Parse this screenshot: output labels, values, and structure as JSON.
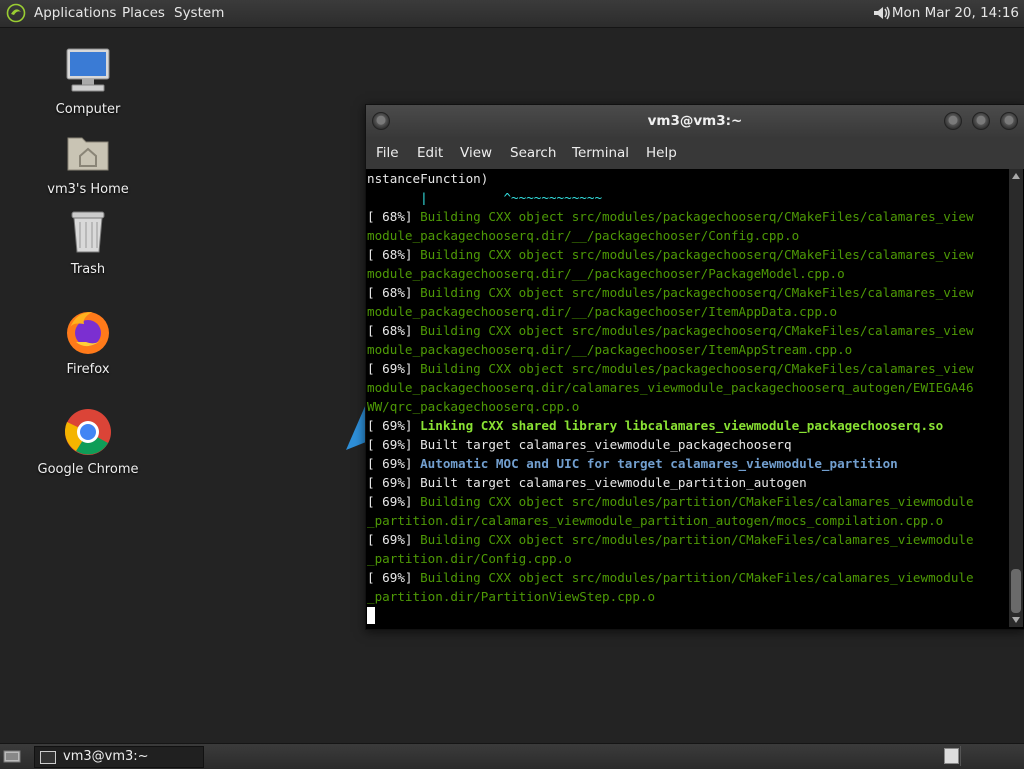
{
  "top_panel": {
    "menus": [
      "Applications",
      "Places",
      "System"
    ],
    "clock": "Mon Mar 20, 14:16"
  },
  "desktop_icons": [
    {
      "label": "Computer",
      "icon": "computer-icon"
    },
    {
      "label": "vm3's Home",
      "icon": "home-folder-icon"
    },
    {
      "label": "Trash",
      "icon": "trash-icon"
    },
    {
      "label": "Firefox",
      "icon": "firefox-icon"
    },
    {
      "label": "Google Chrome",
      "icon": "chrome-icon"
    }
  ],
  "terminal": {
    "title": "vm3@vm3:~",
    "menu": [
      "File",
      "Edit",
      "View",
      "Search",
      "Terminal",
      "Help"
    ],
    "lines": [
      {
        "prefix": "",
        "text": "nstanceFunction)",
        "style": ""
      },
      {
        "prefix": "",
        "text": "       |          ^~~~~~~~~~~~~",
        "style": "cy"
      },
      {
        "prefix": "[ 68%] ",
        "text": "Building CXX object src/modules/packagechooserq/CMakeFiles/calamares_view",
        "style": "g"
      },
      {
        "prefix": "",
        "text": "module_packagechooserq.dir/__/packagechooser/Config.cpp.o",
        "style": "g"
      },
      {
        "prefix": "[ 68%] ",
        "text": "Building CXX object src/modules/packagechooserq/CMakeFiles/calamares_view",
        "style": "g"
      },
      {
        "prefix": "",
        "text": "module_packagechooserq.dir/__/packagechooser/PackageModel.cpp.o",
        "style": "g"
      },
      {
        "prefix": "[ 68%] ",
        "text": "Building CXX object src/modules/packagechooserq/CMakeFiles/calamares_view",
        "style": "g"
      },
      {
        "prefix": "",
        "text": "module_packagechooserq.dir/__/packagechooser/ItemAppData.cpp.o",
        "style": "g"
      },
      {
        "prefix": "[ 68%] ",
        "text": "Building CXX object src/modules/packagechooserq/CMakeFiles/calamares_view",
        "style": "g"
      },
      {
        "prefix": "",
        "text": "module_packagechooserq.dir/__/packagechooser/ItemAppStream.cpp.o",
        "style": "g"
      },
      {
        "prefix": "[ 69%] ",
        "text": "Building CXX object src/modules/packagechooserq/CMakeFiles/calamares_view",
        "style": "g"
      },
      {
        "prefix": "",
        "text": "module_packagechooserq.dir/calamares_viewmodule_packagechooserq_autogen/EWIEGA46",
        "style": "g"
      },
      {
        "prefix": "",
        "text": "WW/qrc_packagechooserq.cpp.o",
        "style": "g"
      },
      {
        "prefix": "[ 69%] ",
        "text": "Linking CXX shared library libcalamares_viewmodule_packagechooserq.so",
        "style": "gb"
      },
      {
        "prefix": "[ 69%] ",
        "text": "Built target calamares_viewmodule_packagechooserq",
        "style": ""
      },
      {
        "prefix": "[ 69%] ",
        "text": "Automatic MOC and UIC for target calamares_viewmodule_partition",
        "style": "bb"
      },
      {
        "prefix": "[ 69%] ",
        "text": "Built target calamares_viewmodule_partition_autogen",
        "style": ""
      },
      {
        "prefix": "[ 69%] ",
        "text": "Building CXX object src/modules/partition/CMakeFiles/calamares_viewmodule",
        "style": "g"
      },
      {
        "prefix": "",
        "text": "_partition.dir/calamares_viewmodule_partition_autogen/mocs_compilation.cpp.o",
        "style": "g"
      },
      {
        "prefix": "[ 69%] ",
        "text": "Building CXX object src/modules/partition/CMakeFiles/calamares_viewmodule",
        "style": "g"
      },
      {
        "prefix": "",
        "text": "_partition.dir/Config.cpp.o",
        "style": "g"
      },
      {
        "prefix": "[ 69%] ",
        "text": "Building CXX object src/modules/partition/CMakeFiles/calamares_viewmodule",
        "style": "g"
      },
      {
        "prefix": "",
        "text": "_partition.dir/PartitionViewStep.cpp.o",
        "style": "g"
      }
    ]
  },
  "taskbar": {
    "task_label": "vm3@vm3:~"
  }
}
